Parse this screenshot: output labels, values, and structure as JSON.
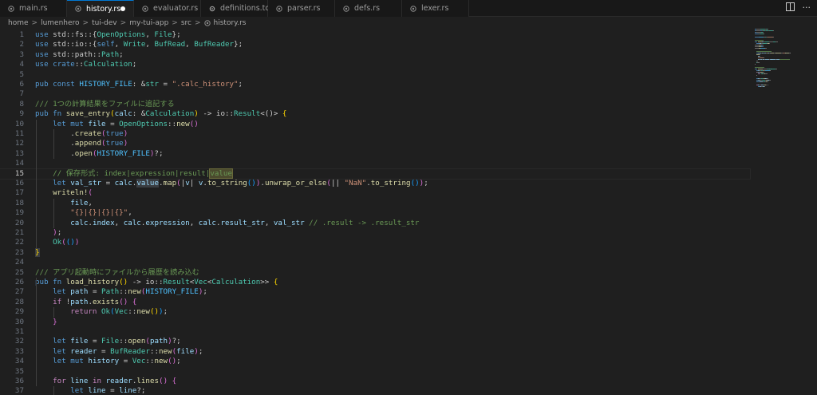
{
  "tabs": [
    {
      "label": "main.rs",
      "icon": "rust-file-icon"
    },
    {
      "label": "history.rs",
      "icon": "rust-file-icon",
      "active": true,
      "modified": true
    },
    {
      "label": "evaluator.rs",
      "icon": "rust-file-icon"
    },
    {
      "label": "definitions.toml",
      "icon": "gear-icon"
    },
    {
      "label": "parser.rs",
      "icon": "rust-file-icon"
    },
    {
      "label": "defs.rs",
      "icon": "rust-file-icon"
    },
    {
      "label": "lexer.rs",
      "icon": "rust-file-icon"
    }
  ],
  "breadcrumb": [
    "home",
    "lumenhero",
    "tui-dev",
    "my-tui-app",
    "src",
    "history.rs"
  ],
  "breadcrumb_sep": ">",
  "current_line": 15,
  "lines": [
    {
      "n": "1",
      "t": [
        [
          "kw",
          "use"
        ],
        [
          "",
          " std::fs::{"
        ],
        [
          "ty",
          "OpenOptions"
        ],
        [
          "",
          ", "
        ],
        [
          "ty",
          "File"
        ],
        [
          "",
          "};"
        ]
      ]
    },
    {
      "n": "2",
      "t": [
        [
          "kw",
          "use"
        ],
        [
          "",
          " std::io::{"
        ],
        [
          "kw",
          "self"
        ],
        [
          "",
          ", "
        ],
        [
          "ty",
          "Write"
        ],
        [
          "",
          ", "
        ],
        [
          "ty",
          "BufRead"
        ],
        [
          "",
          ", "
        ],
        [
          "ty",
          "BufReader"
        ],
        [
          "",
          "};"
        ]
      ]
    },
    {
      "n": "3",
      "t": [
        [
          "kw",
          "use"
        ],
        [
          "",
          " std::path::"
        ],
        [
          "ty",
          "Path"
        ],
        [
          "",
          ";"
        ]
      ]
    },
    {
      "n": "4",
      "t": [
        [
          "kw",
          "use"
        ],
        [
          "",
          " "
        ],
        [
          "kw",
          "crate"
        ],
        [
          "",
          "::"
        ],
        [
          "ty",
          "Calculation"
        ],
        [
          "",
          ";"
        ]
      ]
    },
    {
      "n": "5",
      "t": []
    },
    {
      "n": "6",
      "t": [
        [
          "kw",
          "pub const"
        ],
        [
          "",
          " "
        ],
        [
          "cn",
          "HISTORY_FILE"
        ],
        [
          "",
          ": &"
        ],
        [
          "ty",
          "str"
        ],
        [
          "",
          " = "
        ],
        [
          "st",
          "\".calc_history\""
        ],
        [
          "",
          ";"
        ]
      ]
    },
    {
      "n": "7",
      "t": []
    },
    {
      "n": "8",
      "t": [
        [
          "cm",
          "/// 1つの計算結果をファイルに追記する"
        ]
      ]
    },
    {
      "n": "9",
      "t": [
        [
          "kw",
          "pub fn"
        ],
        [
          "",
          " "
        ],
        [
          "fn",
          "save_entry"
        ],
        [
          "br1",
          "("
        ],
        [
          "vr",
          "calc"
        ],
        [
          "",
          ": &"
        ],
        [
          "ty",
          "Calculation"
        ],
        [
          "br1",
          ")"
        ],
        [
          "",
          " -> io::"
        ],
        [
          "ty",
          "Result"
        ],
        [
          "",
          "<()> "
        ],
        [
          "br1",
          "{"
        ]
      ]
    },
    {
      "n": "10",
      "t": [
        [
          "",
          "    "
        ],
        [
          "kw",
          "let mut"
        ],
        [
          "",
          " "
        ],
        [
          "vr",
          "file"
        ],
        [
          "",
          " = "
        ],
        [
          "ty",
          "OpenOptions"
        ],
        [
          "",
          "::"
        ],
        [
          "fn",
          "new"
        ],
        [
          "br2",
          "()"
        ]
      ]
    },
    {
      "n": "11",
      "t": [
        [
          "",
          "        ."
        ],
        [
          "fn",
          "create"
        ],
        [
          "br2",
          "("
        ],
        [
          "kw",
          "true"
        ],
        [
          "br2",
          ")"
        ]
      ]
    },
    {
      "n": "12",
      "t": [
        [
          "",
          "        ."
        ],
        [
          "fn",
          "append"
        ],
        [
          "br2",
          "("
        ],
        [
          "kw",
          "true"
        ],
        [
          "br2",
          ")"
        ]
      ]
    },
    {
      "n": "13",
      "t": [
        [
          "",
          "        ."
        ],
        [
          "fn",
          "open"
        ],
        [
          "br2",
          "("
        ],
        [
          "cn",
          "HISTORY_FILE"
        ],
        [
          "br2",
          ")"
        ],
        [
          "",
          "?;"
        ]
      ]
    },
    {
      "n": "14",
      "t": []
    },
    {
      "n": "15",
      "t": [
        [
          "",
          "    "
        ],
        [
          "cm",
          "// 保存形式: index|expression|result|"
        ],
        [
          "cmhl",
          "value"
        ]
      ]
    },
    {
      "n": "16",
      "t": [
        [
          "",
          "    "
        ],
        [
          "kw",
          "let"
        ],
        [
          "",
          " "
        ],
        [
          "vr",
          "val_str"
        ],
        [
          "",
          " = "
        ],
        [
          "vr",
          "calc"
        ],
        [
          "",
          "."
        ],
        [
          "vrhl",
          "value"
        ],
        [
          "",
          "."
        ],
        [
          "fn",
          "map"
        ],
        [
          "br2",
          "("
        ],
        [
          "",
          "|"
        ],
        [
          "vr",
          "v"
        ],
        [
          "",
          "| "
        ],
        [
          "vr",
          "v"
        ],
        [
          "",
          "."
        ],
        [
          "fn",
          "to_string"
        ],
        [
          "br3",
          "()"
        ],
        [
          "br2",
          ")"
        ],
        [
          "",
          "."
        ],
        [
          "fn",
          "unwrap_or_else"
        ],
        [
          "br2",
          "("
        ],
        [
          "",
          "|| "
        ],
        [
          "st",
          "\"NaN\""
        ],
        [
          "",
          "."
        ],
        [
          "fn",
          "to_string"
        ],
        [
          "br3",
          "()"
        ],
        [
          "br2",
          ")"
        ],
        [
          "",
          ";"
        ]
      ]
    },
    {
      "n": "17",
      "t": [
        [
          "",
          "    "
        ],
        [
          "fn",
          "writeln!"
        ],
        [
          "br2",
          "("
        ]
      ]
    },
    {
      "n": "18",
      "t": [
        [
          "",
          "        "
        ],
        [
          "vr",
          "file"
        ],
        [
          "",
          ","
        ]
      ]
    },
    {
      "n": "19",
      "t": [
        [
          "",
          "        "
        ],
        [
          "st",
          "\"{}|{}|{}|{}\""
        ],
        [
          "",
          ","
        ]
      ]
    },
    {
      "n": "20",
      "t": [
        [
          "",
          "        "
        ],
        [
          "vr",
          "calc"
        ],
        [
          "",
          "."
        ],
        [
          "vr",
          "index"
        ],
        [
          "",
          ", "
        ],
        [
          "vr",
          "calc"
        ],
        [
          "",
          "."
        ],
        [
          "vr",
          "expression"
        ],
        [
          "",
          ", "
        ],
        [
          "vr",
          "calc"
        ],
        [
          "",
          "."
        ],
        [
          "vr",
          "result_str"
        ],
        [
          "",
          ", "
        ],
        [
          "vr",
          "val_str"
        ],
        [
          "",
          " "
        ],
        [
          "cm",
          "// .result -> .result_str"
        ]
      ]
    },
    {
      "n": "21",
      "t": [
        [
          "",
          "    "
        ],
        [
          "br2",
          ")"
        ],
        [
          "",
          ";"
        ]
      ]
    },
    {
      "n": "22",
      "t": [
        [
          "",
          "    "
        ],
        [
          "ty",
          "Ok"
        ],
        [
          "br2",
          "("
        ],
        [
          "br3",
          "()"
        ],
        [
          "br2",
          ")"
        ]
      ]
    },
    {
      "n": "23",
      "t": [
        [
          "br1hl",
          "}"
        ]
      ]
    },
    {
      "n": "24",
      "t": []
    },
    {
      "n": "25",
      "t": [
        [
          "cm",
          "/// アプリ起動時にファイルから履歴を読み込む"
        ]
      ]
    },
    {
      "n": "26",
      "t": [
        [
          "kw",
          "pub fn"
        ],
        [
          "",
          " "
        ],
        [
          "fn",
          "load_history"
        ],
        [
          "br1",
          "()"
        ],
        [
          "",
          " -> io::"
        ],
        [
          "ty",
          "Result"
        ],
        [
          "",
          "<"
        ],
        [
          "ty",
          "Vec"
        ],
        [
          "",
          "<"
        ],
        [
          "ty",
          "Calculation"
        ],
        [
          "",
          ">> "
        ],
        [
          "br1",
          "{"
        ]
      ]
    },
    {
      "n": "27",
      "t": [
        [
          "",
          "    "
        ],
        [
          "kw",
          "let"
        ],
        [
          "",
          " "
        ],
        [
          "vr",
          "path"
        ],
        [
          "",
          " = "
        ],
        [
          "ty",
          "Path"
        ],
        [
          "",
          "::"
        ],
        [
          "fn",
          "new"
        ],
        [
          "br2",
          "("
        ],
        [
          "cn",
          "HISTORY_FILE"
        ],
        [
          "br2",
          ")"
        ],
        [
          "",
          ";"
        ]
      ]
    },
    {
      "n": "28",
      "t": [
        [
          "",
          "    "
        ],
        [
          "ctl",
          "if"
        ],
        [
          "",
          " !"
        ],
        [
          "vr",
          "path"
        ],
        [
          "",
          "."
        ],
        [
          "fn",
          "exists"
        ],
        [
          "br2",
          "()"
        ],
        [
          "",
          " "
        ],
        [
          "br2",
          "{"
        ]
      ]
    },
    {
      "n": "29",
      "t": [
        [
          "",
          "        "
        ],
        [
          "ctl",
          "return"
        ],
        [
          "",
          " "
        ],
        [
          "ty",
          "Ok"
        ],
        [
          "br3",
          "("
        ],
        [
          "ty",
          "Vec"
        ],
        [
          "",
          "::"
        ],
        [
          "fn",
          "new"
        ],
        [
          "br1",
          "()"
        ],
        [
          "br3",
          ")"
        ],
        [
          "",
          ";"
        ]
      ]
    },
    {
      "n": "30",
      "t": [
        [
          "",
          "    "
        ],
        [
          "br2",
          "}"
        ]
      ]
    },
    {
      "n": "31",
      "t": []
    },
    {
      "n": "32",
      "t": [
        [
          "",
          "    "
        ],
        [
          "kw",
          "let"
        ],
        [
          "",
          " "
        ],
        [
          "vr",
          "file"
        ],
        [
          "",
          " = "
        ],
        [
          "ty",
          "File"
        ],
        [
          "",
          "::"
        ],
        [
          "fn",
          "open"
        ],
        [
          "br2",
          "("
        ],
        [
          "vr",
          "path"
        ],
        [
          "br2",
          ")"
        ],
        [
          "",
          "?;"
        ]
      ]
    },
    {
      "n": "33",
      "t": [
        [
          "",
          "    "
        ],
        [
          "kw",
          "let"
        ],
        [
          "",
          " "
        ],
        [
          "vr",
          "reader"
        ],
        [
          "",
          " = "
        ],
        [
          "ty",
          "BufReader"
        ],
        [
          "",
          "::"
        ],
        [
          "fn",
          "new"
        ],
        [
          "br2",
          "("
        ],
        [
          "vr",
          "file"
        ],
        [
          "br2",
          ")"
        ],
        [
          "",
          ";"
        ]
      ]
    },
    {
      "n": "34",
      "t": [
        [
          "",
          "    "
        ],
        [
          "kw",
          "let mut"
        ],
        [
          "",
          " "
        ],
        [
          "vr",
          "history"
        ],
        [
          "",
          " = "
        ],
        [
          "ty",
          "Vec"
        ],
        [
          "",
          "::"
        ],
        [
          "fn",
          "new"
        ],
        [
          "br2",
          "()"
        ],
        [
          "",
          ";"
        ]
      ]
    },
    {
      "n": "35",
      "t": []
    },
    {
      "n": "36",
      "t": [
        [
          "",
          "    "
        ],
        [
          "ctl",
          "for"
        ],
        [
          "",
          " "
        ],
        [
          "vr",
          "line"
        ],
        [
          "",
          " "
        ],
        [
          "ctl",
          "in"
        ],
        [
          "",
          " "
        ],
        [
          "vr",
          "reader"
        ],
        [
          "",
          "."
        ],
        [
          "fn",
          "lines"
        ],
        [
          "br2",
          "()"
        ],
        [
          "",
          " "
        ],
        [
          "br2",
          "{"
        ]
      ]
    },
    {
      "n": "37",
      "t": [
        [
          "",
          "        "
        ],
        [
          "kw",
          "let"
        ],
        [
          "",
          " "
        ],
        [
          "vr",
          "line"
        ],
        [
          "",
          " = "
        ],
        [
          "vr",
          "line"
        ],
        [
          "",
          "?;"
        ]
      ]
    }
  ]
}
